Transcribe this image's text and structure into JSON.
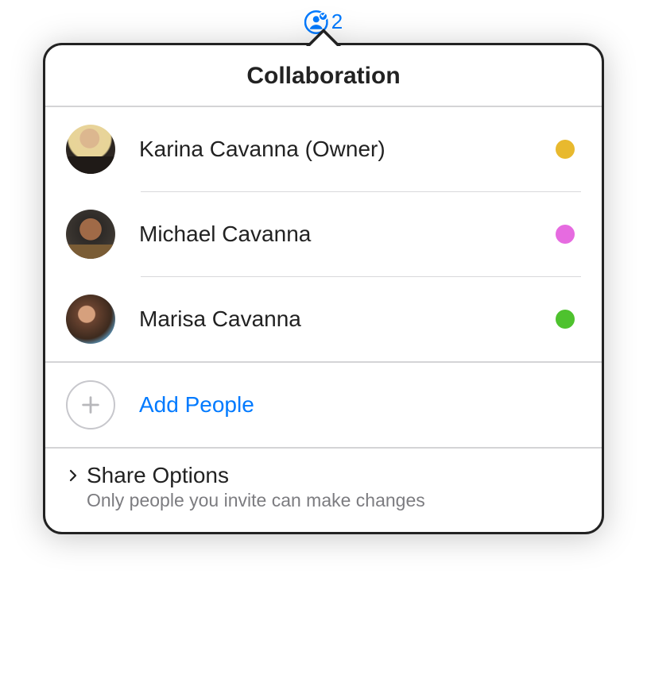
{
  "trigger": {
    "count": "2"
  },
  "header": {
    "title": "Collaboration"
  },
  "participants": [
    {
      "name": "Karina Cavanna (Owner)",
      "dotColor": "#e8b92e"
    },
    {
      "name": "Michael Cavanna",
      "dotColor": "#e66be0"
    },
    {
      "name": "Marisa Cavanna",
      "dotColor": "#4ec22e"
    }
  ],
  "add": {
    "label": "Add People"
  },
  "share": {
    "label": "Share Options",
    "sub": "Only people you invite can make changes"
  }
}
